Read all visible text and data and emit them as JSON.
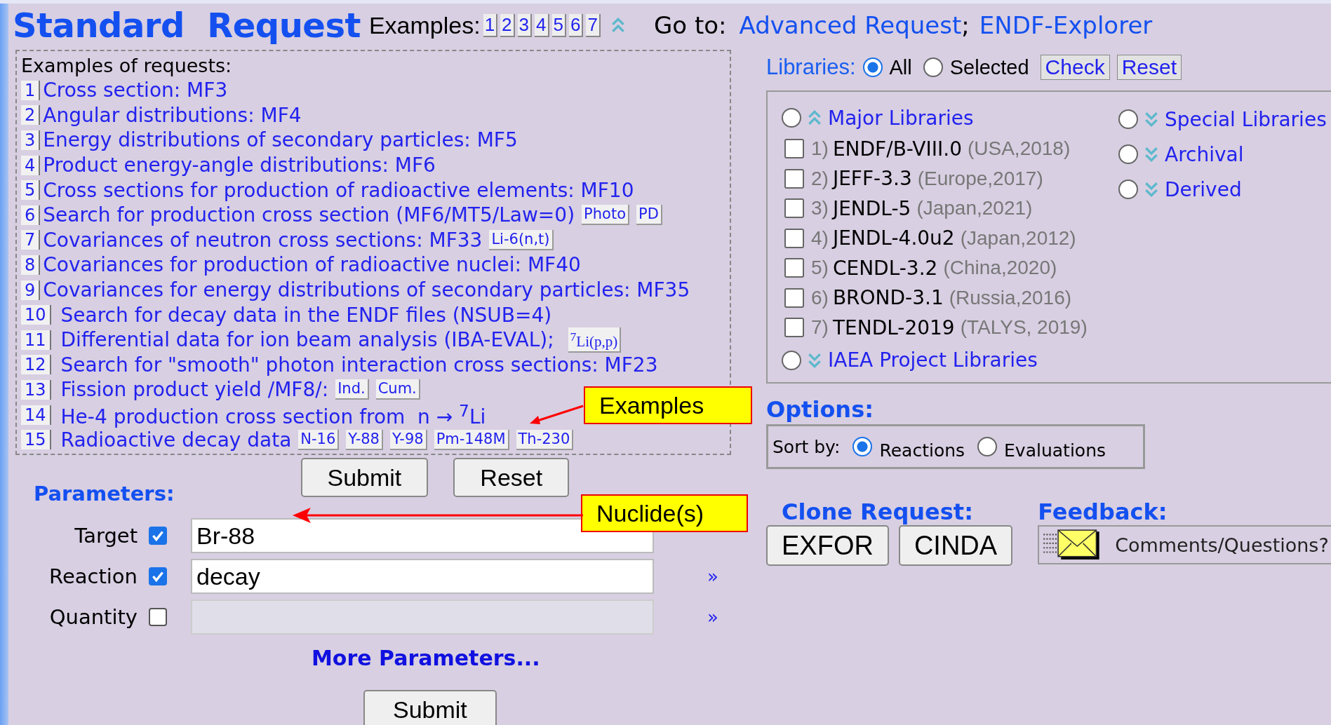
{
  "title": "Standard  Request",
  "examples_nav": {
    "label": "Examples:",
    "links": [
      "1",
      "2",
      "3",
      "4",
      "5",
      "6",
      "7"
    ]
  },
  "goto": {
    "label": "Go to:",
    "links": [
      "Advanced Request",
      "ENDF-Explorer"
    ],
    "separator": ";"
  },
  "examples_panel": {
    "heading": "Examples of requests:",
    "callout": "Examples",
    "items": [
      {
        "number": "1",
        "text": "Cross section: MF3"
      },
      {
        "number": "2",
        "text": "Angular distributions: MF4"
      },
      {
        "number": "3",
        "text": "Energy distributions of secondary particles: MF5"
      },
      {
        "number": "4",
        "text": "Product energy-angle distributions: MF6"
      },
      {
        "number": "5",
        "text": "Cross sections for production of radioactive elements: MF10"
      },
      {
        "number": "6",
        "text": "Search for production cross section (MF6/MT5/Law=0)",
        "buttons": [
          "Photo",
          "PD"
        ]
      },
      {
        "number": "7",
        "text": "Covariances of neutron cross sections: MF33",
        "buttons": [
          "Li-6(n,t)"
        ]
      },
      {
        "number": "8",
        "text": "Covariances for production of radioactive nuclei: MF40"
      },
      {
        "number": "9",
        "text": "Covariances for energy distributions of secondary particles: MF35"
      },
      {
        "number": "10",
        "text": "Search for decay data in the ENDF files (NSUB=4)"
      },
      {
        "number": "11",
        "text": "Differential data for ion beam analysis (IBA-EVAL);",
        "buttons": [
          "$^{7}$Li(p,p)"
        ]
      },
      {
        "number": "12",
        "text": "Search for \"smooth\" photon interaction cross sections: MF23"
      },
      {
        "number": "13",
        "text": "Fission product yield /MF8/:",
        "buttons": [
          "Ind.",
          "Cum."
        ]
      },
      {
        "number": "14",
        "text": "He-4 production cross section from  n → $^{7}$Li"
      },
      {
        "number": "15",
        "text": "Radioactive decay data",
        "buttons": [
          "N-16",
          "Y-88",
          "Y-98",
          "Pm-148M",
          "Th-230"
        ]
      }
    ]
  },
  "form_buttons": [
    "Submit",
    "Reset"
  ],
  "parameters": {
    "heading": "Parameters:",
    "callout": "Nuclide(s)",
    "rows": [
      {
        "label": "Target",
        "checked": true,
        "value": "Br-88",
        "disabled": false
      },
      {
        "label": "Reaction",
        "checked": true,
        "value": "decay",
        "disabled": false,
        "expander": "»"
      },
      {
        "label": "Quantity",
        "checked": false,
        "disabled": true,
        "expander": "»"
      }
    ],
    "more_link": "More Parameters...",
    "submit": "Submit"
  },
  "libraries": {
    "label": "Libraries:",
    "scope": [
      {
        "label": "All",
        "selected": true
      },
      {
        "label": "Selected",
        "selected": false
      }
    ],
    "buttons": [
      "Check",
      "Reset"
    ],
    "major": {
      "label": "Major Libraries",
      "selected": false,
      "expanded": true,
      "items": [
        {
          "number": "1)",
          "name": "ENDF/B-VIII.0",
          "origin": "(USA,2018)",
          "checked": false
        },
        {
          "number": "2)",
          "name": "JEFF-3.3",
          "origin": "(Europe,2017)",
          "checked": false
        },
        {
          "number": "3)",
          "name": "JENDL-5",
          "origin": "(Japan,2021)",
          "checked": false
        },
        {
          "number": "4)",
          "name": "JENDL-4.0u2",
          "origin": "(Japan,2012)",
          "checked": false
        },
        {
          "number": "5)",
          "name": "CENDL-3.2",
          "origin": "(China,2020)",
          "checked": false
        },
        {
          "number": "6)",
          "name": "BROND-3.1",
          "origin": "(Russia,2016)",
          "checked": false
        },
        {
          "number": "7)",
          "name": "TENDL-2019",
          "origin": "(TALYS, 2019)",
          "checked": false
        }
      ]
    },
    "project": {
      "label": "IAEA Project Libraries",
      "selected": false,
      "expanded": false
    },
    "other_groups": [
      {
        "label": "Special Libraries",
        "selected": false,
        "expanded": false
      },
      {
        "label": "Archival",
        "selected": false,
        "expanded": false
      },
      {
        "label": "Derived",
        "selected": false,
        "expanded": false
      }
    ]
  },
  "options": {
    "heading": "Options:",
    "sort_label": "Sort by:",
    "choices": [
      {
        "label": "Reactions",
        "selected": true
      },
      {
        "label": "Evaluations",
        "selected": false
      }
    ]
  },
  "clone": {
    "heading": "Clone Request:",
    "buttons": [
      "EXFOR",
      "CINDA"
    ]
  },
  "feedback": {
    "heading": "Feedback:",
    "button": "Comments/Questions?"
  }
}
